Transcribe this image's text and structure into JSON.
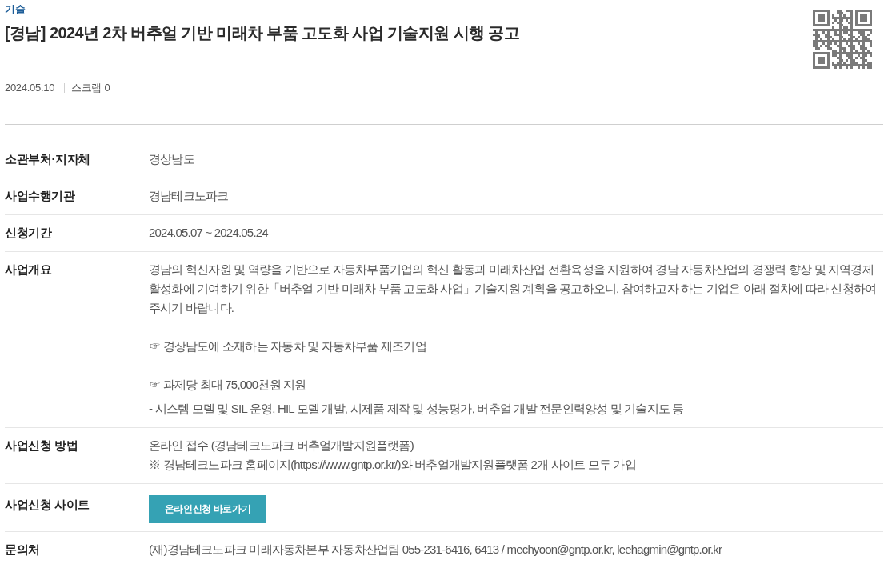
{
  "category": "기술",
  "title": "[경남] 2024년 2차 버추얼 기반 미래차 부품 고도화 사업 기술지원 시행 공고",
  "meta": {
    "date": "2024.05.10",
    "scrap": "스크랩 0"
  },
  "details": [
    {
      "kind": "text",
      "label": "소관부처·지자체",
      "lines": [
        "경상남도"
      ]
    },
    {
      "kind": "text",
      "label": "사업수행기관",
      "lines": [
        "경남테크노파크"
      ]
    },
    {
      "kind": "text",
      "label": "신청기간",
      "lines": [
        "2024.05.07 ~ 2024.05.24"
      ]
    },
    {
      "kind": "paragraphs",
      "label": "사업개요",
      "paragraphs": [
        {
          "lines": [
            "경남의 혁신자원 및 역량을 기반으로 자동차부품기업의 혁신 활동과 미래차산업 전환육성을 지원하여 경남 자동차산업의 경쟁력 향상 및 지역경제 활성화에 기여하기 위한「버추얼 기반 미래차 부품 고도화 사업」기술지원 계획을 공고하오니, 참여하고자 하는 기업은 아래 절차에 따라 신청하여 주시기 바랍니다."
          ]
        },
        {
          "lines": [
            "☞ 경상남도에 소재하는 자동차 및 자동차부품 제조기업"
          ]
        },
        {
          "lines": [
            "☞ 과제당 최대 75,000천원 지원",
            "- 시스템 모델 및 SIL 운영, HIL 모델 개발, 시제품 제작 및 성능평가, 버추얼 개발 전문인력양성 및 기술지도 등"
          ]
        }
      ]
    },
    {
      "kind": "text",
      "label": "사업신청 방법",
      "lines": [
        "온라인 접수 (경남테크노파크 버추얼개발지원플랫폼)",
        "※ 경남테크노파크 홈페이지(https://www.gntp.or.kr/)와 버추얼개발지원플랫폼 2개 사이트 모두 가입"
      ]
    },
    {
      "kind": "button",
      "label": "사업신청 사이트",
      "button": "온라인신청 바로가기"
    },
    {
      "kind": "text",
      "label": "문의처",
      "lines": [
        "(재)경남테크노파크 미래자동차본부 자동차산업팀 055-231-6416, 6413 / mechyoon@gntp.or.kr, leehagmin@gntp.or.kr"
      ]
    }
  ]
}
